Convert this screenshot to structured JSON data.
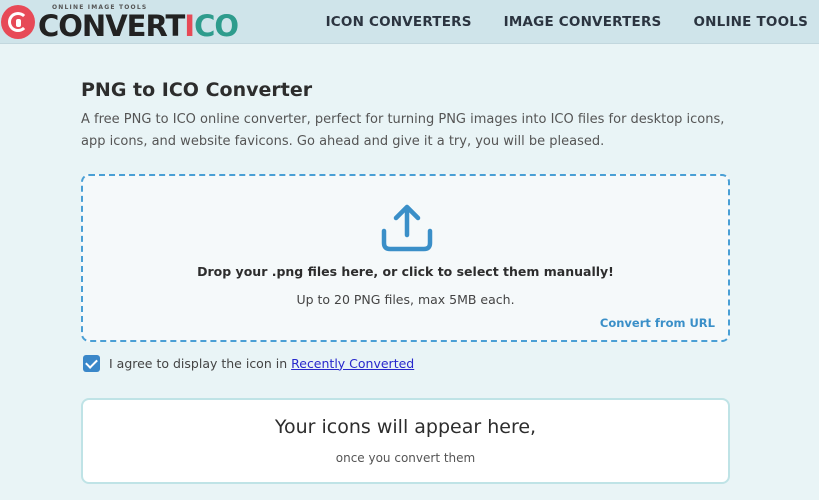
{
  "header": {
    "logo_tagline": "ONLINE IMAGE TOOLS",
    "logo_part1": "CONVERT",
    "logo_part2": "I",
    "logo_part3": "CO",
    "nav": [
      {
        "label": "ICON CONVERTERS"
      },
      {
        "label": "IMAGE CONVERTERS"
      },
      {
        "label": "ONLINE TOOLS"
      }
    ]
  },
  "main": {
    "title": "PNG to ICO Converter",
    "description": "A free PNG to ICO online converter, perfect for turning PNG images into ICO files for desktop icons, app icons, and website favicons. Go ahead and give it a try, you will be pleased.",
    "dropzone": {
      "icon": "upload-icon",
      "primary_text": "Drop your .png files here, or click to select them manually!",
      "secondary_text": "Up to 20 PNG files, max 5MB each.",
      "url_link": "Convert from URL"
    },
    "agree": {
      "checked": true,
      "text": "I agree to display the icon in",
      "link": "Recently Converted"
    },
    "results": {
      "title": "Your icons will appear here,",
      "subtitle": "once you convert them"
    }
  },
  "colors": {
    "header_bg": "#cfe4ea",
    "page_bg": "#e9f4f6",
    "accent_blue": "#4a9fd5",
    "brand_red": "#e74a57",
    "brand_teal": "#2e9c8d"
  }
}
